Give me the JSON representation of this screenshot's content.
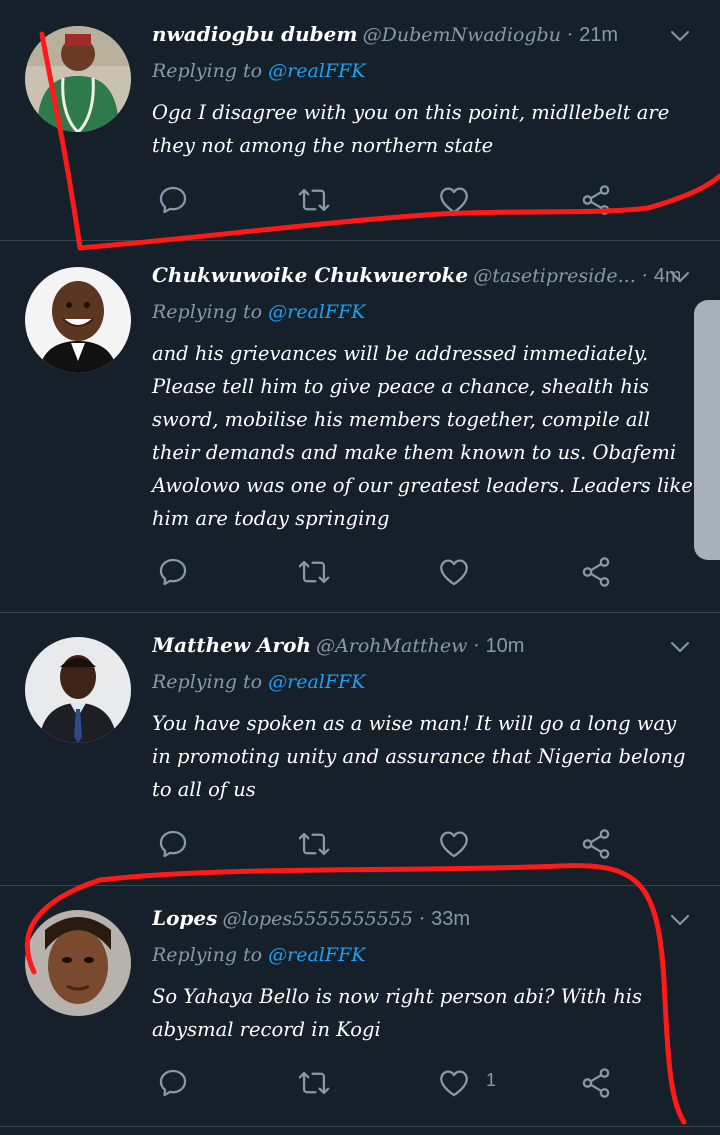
{
  "tweets": [
    {
      "name": "nwadiogbu dubem",
      "handle": "@DubemNwadiogbu",
      "sep": " · ",
      "time": "21m",
      "reply_prefix": "Replying to ",
      "reply_to": "@realFFK",
      "text": "Oga I disagree with you on this point, midllebelt are they not among the northern state",
      "likes": "",
      "avatar_icon": "avatar-man-green-shirt"
    },
    {
      "name": "Chukwuwoike Chukwueroke",
      "handle": "@tasetipreside...",
      "sep": " · ",
      "time": "4m",
      "reply_prefix": "Replying to ",
      "reply_to": "@realFFK",
      "text": "and his grievances will be addressed immediately. Please tell him to give peace a chance, shealth his sword,  mobilise his members together, compile all their demands and make them known to us. Obafemi Awolowo was one of our greatest leaders. Leaders like him are today springing",
      "likes": "",
      "avatar_icon": "avatar-man-smiling"
    },
    {
      "name": "Matthew Aroh",
      "handle": "@ArohMatthew",
      "sep": " · ",
      "time": "10m",
      "reply_prefix": "Replying to ",
      "reply_to": "@realFFK",
      "text": "You have spoken as a wise man! It will go a long way in promoting unity and assurance that Nigeria belong to all of us",
      "likes": "",
      "avatar_icon": "avatar-man-suit"
    },
    {
      "name": "Lopes",
      "handle": "@lopes5555555555",
      "sep": " · ",
      "time": "33m",
      "reply_prefix": "Replying to ",
      "reply_to": "@realFFK",
      "text": "So Yahaya Bello is now right person abi? With his abysmal record in Kogi",
      "likes": "1",
      "avatar_icon": "avatar-woman"
    }
  ],
  "icons": [
    "chevron-down-icon",
    "reply-icon",
    "retweet-icon",
    "like-icon",
    "share-icon"
  ],
  "colors": {
    "background": "#15202b",
    "text": "#ffffff",
    "muted": "#8899a6",
    "mention": "#1da1f2",
    "divider": "#38444d",
    "annotation": "#ff1a1a"
  }
}
